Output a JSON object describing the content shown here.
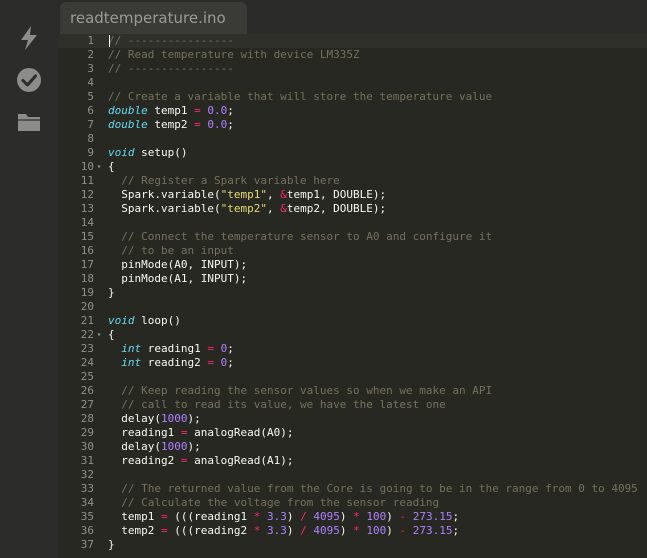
{
  "sidebar": {
    "icons": [
      "flash-icon",
      "verify-check-icon",
      "folder-icon"
    ]
  },
  "tab": {
    "title": "readtemperature.ino"
  },
  "colors": {
    "background": "#272822",
    "comment": "#75715e",
    "keyword": "#66d9ef",
    "number": "#ae81ff",
    "string": "#e6db74",
    "operator": "#f92672"
  },
  "editor": {
    "active_line": 1,
    "lines": [
      {
        "n": "1",
        "fold": false,
        "tokens": [
          [
            "c",
            "// ----------------"
          ]
        ]
      },
      {
        "n": "2",
        "fold": false,
        "tokens": [
          [
            "c",
            "// Read temperature with device LM335Z"
          ]
        ]
      },
      {
        "n": "3",
        "fold": false,
        "tokens": [
          [
            "c",
            "// ----------------"
          ]
        ]
      },
      {
        "n": "4",
        "fold": false,
        "tokens": []
      },
      {
        "n": "5",
        "fold": false,
        "tokens": [
          [
            "c",
            "// Create a variable that will store the temperature value"
          ]
        ]
      },
      {
        "n": "6",
        "fold": false,
        "tokens": [
          [
            "t",
            "double"
          ],
          [
            "p",
            " temp1 "
          ],
          [
            "o",
            "="
          ],
          [
            "p",
            " "
          ],
          [
            "n",
            "0.0"
          ],
          [
            "p",
            ";"
          ]
        ]
      },
      {
        "n": "7",
        "fold": false,
        "tokens": [
          [
            "t",
            "double"
          ],
          [
            "p",
            " temp2 "
          ],
          [
            "o",
            "="
          ],
          [
            "p",
            " "
          ],
          [
            "n",
            "0.0"
          ],
          [
            "p",
            ";"
          ]
        ]
      },
      {
        "n": "8",
        "fold": false,
        "tokens": []
      },
      {
        "n": "9",
        "fold": false,
        "tokens": [
          [
            "t",
            "void"
          ],
          [
            "p",
            " setup()"
          ]
        ]
      },
      {
        "n": "10",
        "fold": true,
        "tokens": [
          [
            "p",
            "{"
          ]
        ]
      },
      {
        "n": "11",
        "fold": false,
        "tokens": [
          [
            "p",
            "  "
          ],
          [
            "c",
            "// Register a Spark variable here"
          ]
        ]
      },
      {
        "n": "12",
        "fold": false,
        "tokens": [
          [
            "p",
            "  Spark.variable("
          ],
          [
            "s",
            "\"temp1\""
          ],
          [
            "p",
            ", "
          ],
          [
            "o",
            "&"
          ],
          [
            "p",
            "temp1, DOUBLE);"
          ]
        ]
      },
      {
        "n": "13",
        "fold": false,
        "tokens": [
          [
            "p",
            "  Spark.variable("
          ],
          [
            "s",
            "\"temp2\""
          ],
          [
            "p",
            ", "
          ],
          [
            "o",
            "&"
          ],
          [
            "p",
            "temp2, DOUBLE);"
          ]
        ]
      },
      {
        "n": "14",
        "fold": false,
        "tokens": []
      },
      {
        "n": "15",
        "fold": false,
        "tokens": [
          [
            "p",
            "  "
          ],
          [
            "c",
            "// Connect the temperature sensor to A0 and configure it"
          ]
        ]
      },
      {
        "n": "16",
        "fold": false,
        "tokens": [
          [
            "p",
            "  "
          ],
          [
            "c",
            "// to be an input"
          ]
        ]
      },
      {
        "n": "17",
        "fold": false,
        "tokens": [
          [
            "p",
            "  pinMode(A0, INPUT);"
          ]
        ]
      },
      {
        "n": "18",
        "fold": false,
        "tokens": [
          [
            "p",
            "  pinMode(A1, INPUT);"
          ]
        ]
      },
      {
        "n": "19",
        "fold": false,
        "tokens": [
          [
            "p",
            "}"
          ]
        ]
      },
      {
        "n": "20",
        "fold": false,
        "tokens": []
      },
      {
        "n": "21",
        "fold": false,
        "tokens": [
          [
            "t",
            "void"
          ],
          [
            "p",
            " loop()"
          ]
        ]
      },
      {
        "n": "22",
        "fold": true,
        "tokens": [
          [
            "p",
            "{"
          ]
        ]
      },
      {
        "n": "23",
        "fold": false,
        "tokens": [
          [
            "p",
            "  "
          ],
          [
            "t",
            "int"
          ],
          [
            "p",
            " reading1 "
          ],
          [
            "o",
            "="
          ],
          [
            "p",
            " "
          ],
          [
            "n",
            "0"
          ],
          [
            "p",
            ";"
          ]
        ]
      },
      {
        "n": "24",
        "fold": false,
        "tokens": [
          [
            "p",
            "  "
          ],
          [
            "t",
            "int"
          ],
          [
            "p",
            " reading2 "
          ],
          [
            "o",
            "="
          ],
          [
            "p",
            " "
          ],
          [
            "n",
            "0"
          ],
          [
            "p",
            ";"
          ]
        ]
      },
      {
        "n": "25",
        "fold": false,
        "tokens": []
      },
      {
        "n": "26",
        "fold": false,
        "tokens": [
          [
            "p",
            "  "
          ],
          [
            "c",
            "// Keep reading the sensor values so when we make an API"
          ]
        ]
      },
      {
        "n": "27",
        "fold": false,
        "tokens": [
          [
            "p",
            "  "
          ],
          [
            "c",
            "// call to read its value, we have the latest one"
          ]
        ]
      },
      {
        "n": "28",
        "fold": false,
        "tokens": [
          [
            "p",
            "  delay("
          ],
          [
            "n",
            "1000"
          ],
          [
            "p",
            ");"
          ]
        ]
      },
      {
        "n": "29",
        "fold": false,
        "tokens": [
          [
            "p",
            "  reading1 "
          ],
          [
            "o",
            "="
          ],
          [
            "p",
            " analogRead(A0);"
          ]
        ]
      },
      {
        "n": "30",
        "fold": false,
        "tokens": [
          [
            "p",
            "  delay("
          ],
          [
            "n",
            "1000"
          ],
          [
            "p",
            ");"
          ]
        ]
      },
      {
        "n": "31",
        "fold": false,
        "tokens": [
          [
            "p",
            "  reading2 "
          ],
          [
            "o",
            "="
          ],
          [
            "p",
            " analogRead(A1);"
          ]
        ]
      },
      {
        "n": "32",
        "fold": false,
        "tokens": []
      },
      {
        "n": "33",
        "fold": false,
        "tokens": [
          [
            "p",
            "  "
          ],
          [
            "c",
            "// The returned value from the Core is going to be in the range from 0 to 4095"
          ]
        ]
      },
      {
        "n": "34",
        "fold": false,
        "tokens": [
          [
            "p",
            "  "
          ],
          [
            "c",
            "// Calculate the voltage from the sensor reading"
          ]
        ]
      },
      {
        "n": "35",
        "fold": false,
        "tokens": [
          [
            "p",
            "  temp1 "
          ],
          [
            "o",
            "="
          ],
          [
            "p",
            " (((reading1 "
          ],
          [
            "o",
            "*"
          ],
          [
            "p",
            " "
          ],
          [
            "n",
            "3.3"
          ],
          [
            "p",
            ") "
          ],
          [
            "o",
            "/"
          ],
          [
            "p",
            " "
          ],
          [
            "n",
            "4095"
          ],
          [
            "p",
            ") "
          ],
          [
            "o",
            "*"
          ],
          [
            "p",
            " "
          ],
          [
            "n",
            "100"
          ],
          [
            "p",
            ") "
          ],
          [
            "o",
            "-"
          ],
          [
            "p",
            " "
          ],
          [
            "n",
            "273.15"
          ],
          [
            "p",
            ";"
          ]
        ]
      },
      {
        "n": "36",
        "fold": false,
        "tokens": [
          [
            "p",
            "  temp2 "
          ],
          [
            "o",
            "="
          ],
          [
            "p",
            " (((reading2 "
          ],
          [
            "o",
            "*"
          ],
          [
            "p",
            " "
          ],
          [
            "n",
            "3.3"
          ],
          [
            "p",
            ") "
          ],
          [
            "o",
            "/"
          ],
          [
            "p",
            " "
          ],
          [
            "n",
            "4095"
          ],
          [
            "p",
            ") "
          ],
          [
            "o",
            "*"
          ],
          [
            "p",
            " "
          ],
          [
            "n",
            "100"
          ],
          [
            "p",
            ") "
          ],
          [
            "o",
            "-"
          ],
          [
            "p",
            " "
          ],
          [
            "n",
            "273.15"
          ],
          [
            "p",
            ";"
          ]
        ]
      },
      {
        "n": "37",
        "fold": false,
        "tokens": [
          [
            "p",
            "}"
          ]
        ]
      }
    ]
  }
}
